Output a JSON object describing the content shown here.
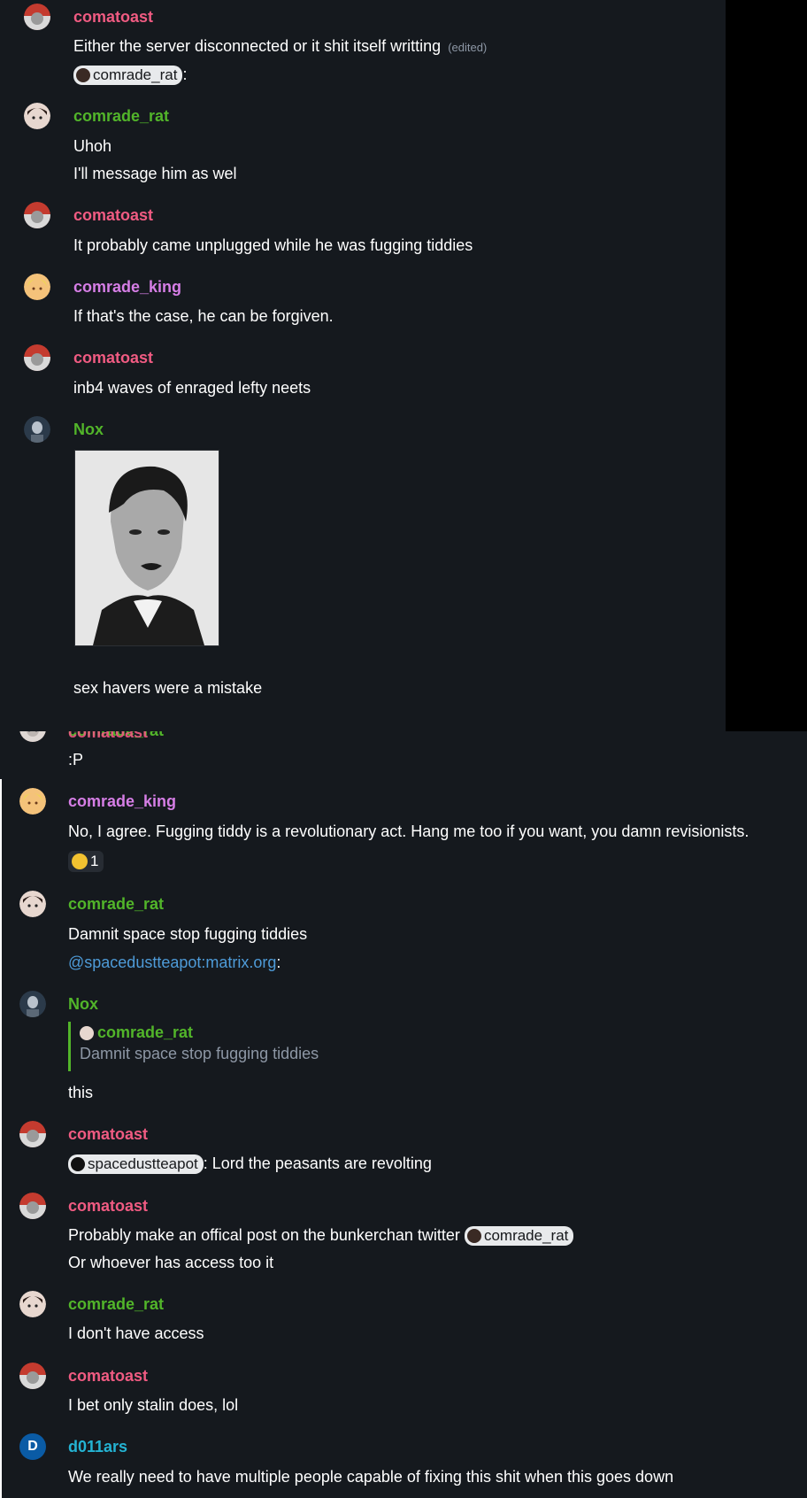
{
  "colors": {
    "background": "#15191e",
    "comatoast": "#f05b82",
    "comrade_rat": "#52b52a",
    "comrade_king": "#d67ee6",
    "nox": "#52b52a",
    "d011ars": "#24b3d3",
    "link": "#4e9bd8",
    "muted": "#8d97a5"
  },
  "top_pane": {
    "messages": [
      {
        "sender": "comatoast",
        "line1": "Either the server disconnected or it shit itself writting",
        "edited": "(edited)",
        "mention": "comrade_rat",
        "after_mention": ":"
      },
      {
        "sender": "comrade_rat",
        "line1": "Uhoh",
        "line2": "I'll message him as wel"
      },
      {
        "sender": "comatoast",
        "line1": "It probably came unplugged while he was fugging tiddies"
      },
      {
        "sender": "comrade_king",
        "line1": "If that's the case, he can be forgiven."
      },
      {
        "sender": "comatoast",
        "line1": "inb4 waves of enraged lefty neets"
      },
      {
        "sender": "Nox",
        "caption": "sex havers were a mistake"
      }
    ]
  },
  "bottom_pane": {
    "overlap_sender_a": "comatoast",
    "overlap_sender_b": "comrade_rat",
    "overlap_text": ":P",
    "messages": [
      {
        "sender": "comrade_king",
        "line1": "No, I agree. Fugging tiddy is a revolutionary act. Hang me too if you want, you damn revisionists.",
        "reaction_count": "1",
        "reaction_icon": "grinning-face-icon"
      },
      {
        "sender": "comrade_rat",
        "line1": "Damnit space stop fugging tiddies",
        "mention_link": "@spacedustteapot:matrix.org",
        "after_link": ":"
      },
      {
        "sender": "Nox",
        "quote_sender": "comrade_rat",
        "quote_text": "Damnit space stop fugging tiddies",
        "line1": "this"
      },
      {
        "sender": "comatoast",
        "mention": "spacedustteapot",
        "line1": ": Lord the peasants are revolting"
      },
      {
        "sender": "comatoast",
        "line1": "Probably make an offical post on the bunkerchan twitter",
        "mention": "comrade_rat",
        "line2": "Or whoever has access too it"
      },
      {
        "sender": "comrade_rat",
        "line1": "I don't have access"
      },
      {
        "sender": "comatoast",
        "line1": "I bet only stalin does, lol"
      },
      {
        "sender": "d011ars",
        "avatar_letter": "D",
        "line1": "We really need to have multiple people capable of fixing this shit when this goes down"
      }
    ]
  }
}
